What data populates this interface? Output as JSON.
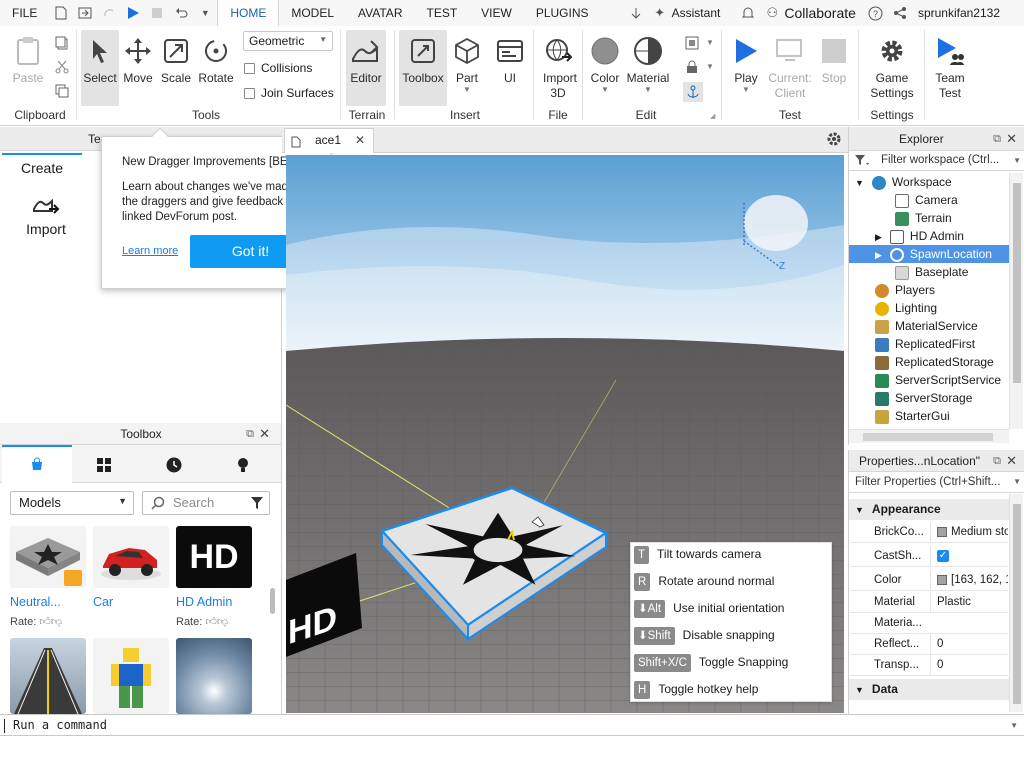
{
  "menubar": {
    "file": "FILE",
    "tabs": [
      {
        "label": "HOME",
        "active": true
      },
      {
        "label": "MODEL",
        "active": false
      },
      {
        "label": "AVATAR",
        "active": false
      },
      {
        "label": "TEST",
        "active": false
      },
      {
        "label": "VIEW",
        "active": false
      },
      {
        "label": "PLUGINS",
        "active": false
      }
    ],
    "assistant": "Assistant",
    "collaborate": "Collaborate",
    "username": "sprunkifan2132"
  },
  "ribbon": {
    "clipboard": {
      "paste": "Paste",
      "label": "Clipboard"
    },
    "tools": {
      "select": "Select",
      "move": "Move",
      "scale": "Scale",
      "rotate": "Rotate",
      "mode_select": "Geometric",
      "collisions": "Collisions",
      "join_surfaces": "Join Surfaces",
      "label": "Tools"
    },
    "terrain": {
      "editor": "Editor",
      "label": "Terrain"
    },
    "insert": {
      "toolbox": "Toolbox",
      "part": "Part",
      "ui": "UI",
      "label": "Insert"
    },
    "file": {
      "import3d": "Import 3D",
      "label": "File"
    },
    "edit": {
      "color": "Color",
      "material": "Material",
      "label": "Edit"
    },
    "test": {
      "play": "Play",
      "current_client": "Current: Client",
      "stop": "Stop",
      "label": "Test"
    },
    "settings": {
      "game_settings": "Game Settings",
      "label": "Settings"
    },
    "team": {
      "team_test": "Team Test"
    }
  },
  "left_panel": {
    "tab_partial": "Te",
    "create_tab": "Create",
    "import": "Import"
  },
  "popup": {
    "title": "New Dragger Improvements [BETA]",
    "body": "Learn about changes we've made to the draggers and give feedback in the linked DevForum post.",
    "learn_more": "Learn more",
    "got_it": "Got it!"
  },
  "toolbox": {
    "title": "Toolbox",
    "category": "Models",
    "search_placeholder": "Search",
    "rate_label": "Rate:",
    "items": [
      {
        "name": "Neutral...",
        "rate": true
      },
      {
        "name": "Car",
        "rate": false
      },
      {
        "name": "HD Admin",
        "rate": true
      }
    ]
  },
  "document_tab": {
    "label": "ace1"
  },
  "hotkeys": [
    {
      "key": "T",
      "action": "Tilt towards camera"
    },
    {
      "key": "R",
      "action": "Rotate around normal"
    },
    {
      "key": "⬇Alt",
      "action": "Use initial orientation"
    },
    {
      "key": "⬇Shift",
      "action": "Disable snapping"
    },
    {
      "key": "Shift+X/C",
      "action": "Toggle Snapping"
    },
    {
      "key": "H",
      "action": "Toggle hotkey help"
    }
  ],
  "viewport": {
    "hd_logo": "HD",
    "gizmo_axis": "Z"
  },
  "explorer": {
    "title": "Explorer",
    "filter_placeholder": "Filter workspace (Ctrl...",
    "items": [
      {
        "label": "Workspace",
        "icon_color": "#2f86c9",
        "selected": false
      },
      {
        "label": "Camera",
        "icon_color": "#6b6b6b",
        "selected": false
      },
      {
        "label": "Terrain",
        "icon_color": "#3a8f5a",
        "selected": false
      },
      {
        "label": "HD Admin",
        "icon_color": "#5b5b5b",
        "selected": false
      },
      {
        "label": "SpawnLocation",
        "icon_color": "#ffffff",
        "selected": true
      },
      {
        "label": "Baseplate",
        "icon_color": "#9a9a9a",
        "selected": false
      },
      {
        "label": "Players",
        "icon_color": "#d38a2a",
        "selected": false
      },
      {
        "label": "Lighting",
        "icon_color": "#e6b400",
        "selected": false
      },
      {
        "label": "MaterialService",
        "icon_color": "#c9a24a",
        "selected": false
      },
      {
        "label": "ReplicatedFirst",
        "icon_color": "#3c7bbf",
        "selected": false
      },
      {
        "label": "ReplicatedStorage",
        "icon_color": "#8a6b3b",
        "selected": false
      },
      {
        "label": "ServerScriptService",
        "icon_color": "#2a8a55",
        "selected": false
      },
      {
        "label": "ServerStorage",
        "icon_color": "#2a7a6a",
        "selected": false
      },
      {
        "label": "StarterGui",
        "icon_color": "#c8a441",
        "selected": false
      }
    ]
  },
  "properties": {
    "title": "Properties...nLocation\"",
    "filter_placeholder": "Filter Properties (Ctrl+Shift...",
    "section_appearance": "Appearance",
    "section_data": "Data",
    "rows": [
      {
        "name": "BrickCo...",
        "value": "Medium sto"
      },
      {
        "name": "CastSh...",
        "value": ""
      },
      {
        "name": "Color",
        "value": "[163, 162, 1"
      },
      {
        "name": "Material",
        "value": "Plastic"
      },
      {
        "name": "Materia...",
        "value": ""
      },
      {
        "name": "Reflect...",
        "value": "0"
      },
      {
        "name": "Transp...",
        "value": "0"
      }
    ]
  },
  "command_bar": {
    "placeholder": "Run a command"
  },
  "colors": {
    "accent": "#1a8cf0",
    "selection": "#0d7ae6",
    "sky_top": "#5b9fd3",
    "ground": "#6b6868"
  }
}
